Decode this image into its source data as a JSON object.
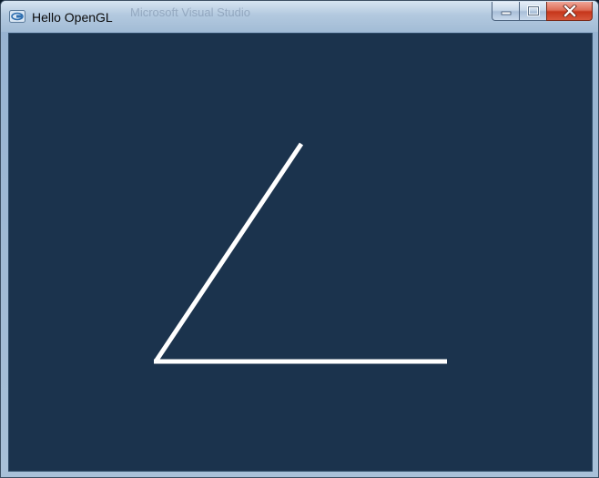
{
  "window": {
    "title": "Hello OpenGL",
    "background_title_text": "Microsoft Visual Studio",
    "icons": {
      "app": "opengl-app-icon",
      "minimize": "minimize-icon",
      "maximize": "maximize-icon",
      "close": "close-icon"
    }
  },
  "colors": {
    "client_background": "#1b334d",
    "line_color": "#ffffff",
    "close_button": "#c6361b"
  }
}
